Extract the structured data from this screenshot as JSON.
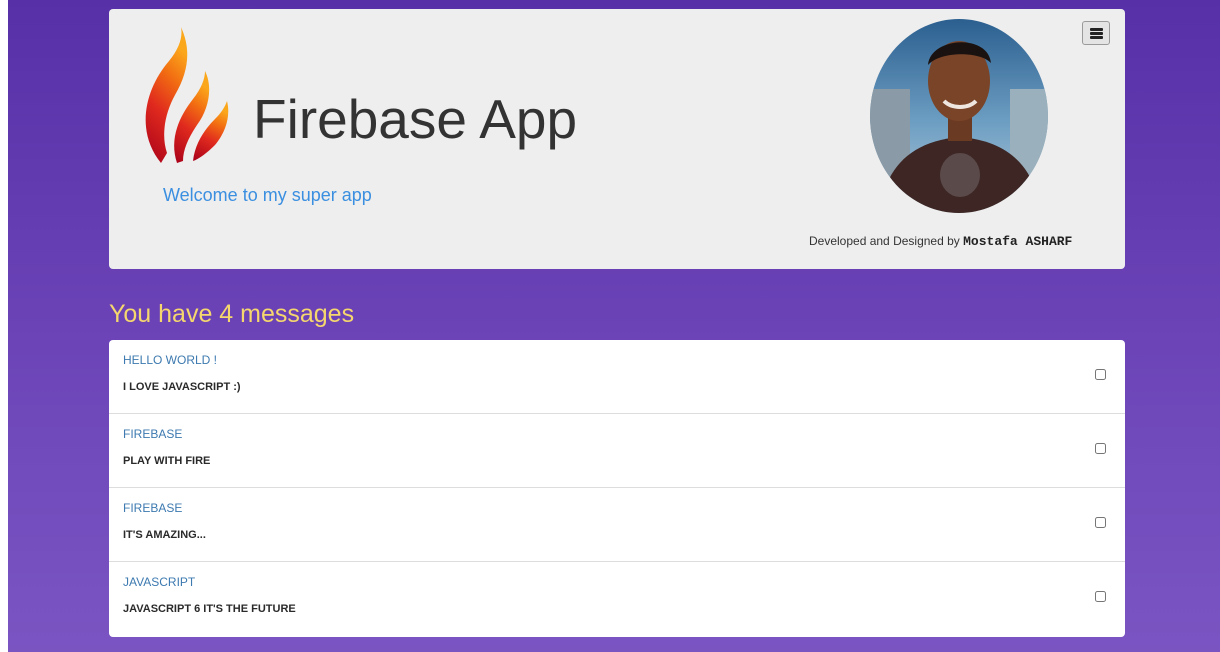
{
  "header": {
    "title": "Firebase App",
    "subtitle": "Welcome to my super app",
    "credit_prefix": "Developed and Designed by",
    "credit_name": "Mostafa ASHARF",
    "logo_icon": "flame-logo-icon",
    "menu_icon": "hamburger-menu-icon"
  },
  "messages_heading": "You have 4 messages",
  "messages": [
    {
      "title": "HELLO WORLD !",
      "body": "I LOVE JAVASCRIPT :)",
      "checked": false
    },
    {
      "title": "FIREBASE",
      "body": "PLAY WITH FIRE",
      "checked": false
    },
    {
      "title": "FIREBASE",
      "body": "IT'S AMAZING...",
      "checked": false
    },
    {
      "title": "JAVASCRIPT",
      "body": "JAVASCRIPT 6 IT'S THE FUTURE",
      "checked": false
    }
  ],
  "colors": {
    "background_top": "#5730a8",
    "background_bottom": "#7a55c2",
    "heading": "#f5d76e",
    "subtitle": "#3b8fe0",
    "message_title": "#3d7ab0"
  }
}
